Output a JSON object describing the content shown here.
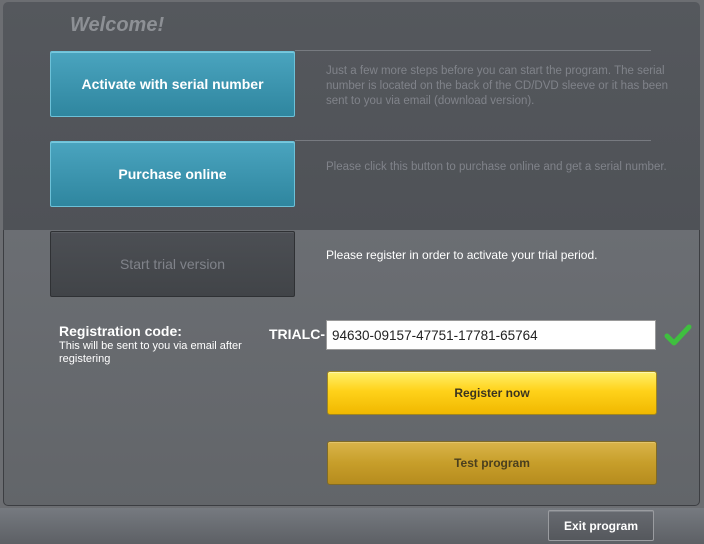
{
  "welcome_title": "Welcome!",
  "options": {
    "activate": {
      "label": "Activate with serial number",
      "description": "Just a few more steps before you can start the program. The serial number is located on the back of the CD/DVD sleeve or it has been sent to you via email (download version)."
    },
    "purchase": {
      "label": "Purchase online",
      "description": "Please click this button to purchase online and get a serial number."
    },
    "trial": {
      "label": "Start trial version",
      "description": "Please register in order to activate your trial period."
    }
  },
  "registration": {
    "label": "Registration code:",
    "hint": "This will be sent to you via email after registering",
    "prefix": "TRIALC-",
    "code": "94630-09157-47751-17781-65764",
    "valid_icon": "checkmark-icon",
    "register_button": "Register now",
    "test_button": "Test program"
  },
  "footer": {
    "exit_button": "Exit program"
  },
  "colors": {
    "accent_blue": "#3a96b0",
    "register_yellow": "#ffd21a",
    "test_gold": "#c79e2a",
    "check_green": "#3fbf3f"
  }
}
